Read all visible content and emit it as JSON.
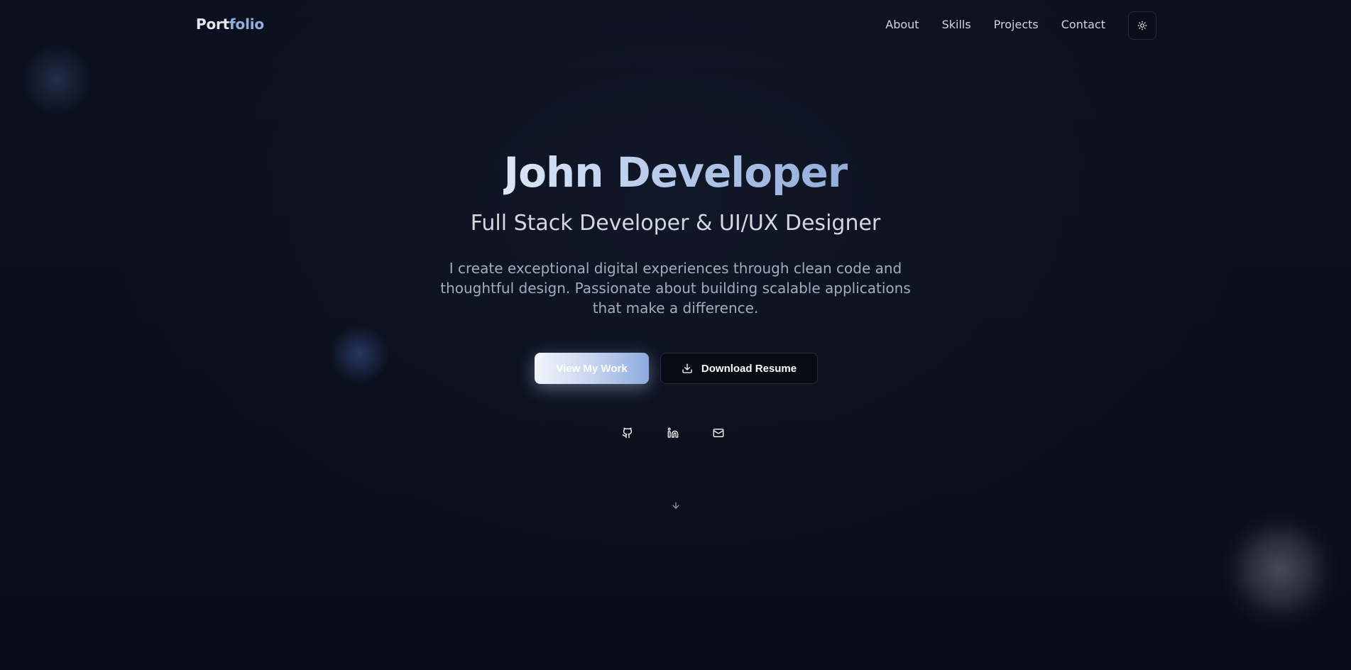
{
  "header": {
    "logo_prefix": "Port",
    "logo_accent": "folio",
    "nav": [
      {
        "label": "About"
      },
      {
        "label": "Skills"
      },
      {
        "label": "Projects"
      },
      {
        "label": "Contact"
      }
    ],
    "theme_toggle_icon": "sun-icon"
  },
  "hero": {
    "name": "John Developer",
    "title": "Full Stack Developer & UI/UX Designer",
    "description": "I create exceptional digital experiences through clean code and thoughtful design. Passionate about building scalable applications that make a difference.",
    "primary_button": "View My Work",
    "secondary_button": "Download Resume",
    "secondary_button_icon": "download-icon",
    "social_icons": [
      "github-icon",
      "linkedin-icon",
      "mail-icon"
    ],
    "scroll_icon": "arrow-down-icon"
  },
  "colors": {
    "background": "#0a0e1a",
    "accent": "#93aee0",
    "text": "#e5e7eb",
    "muted_text": "#a3acbd"
  }
}
